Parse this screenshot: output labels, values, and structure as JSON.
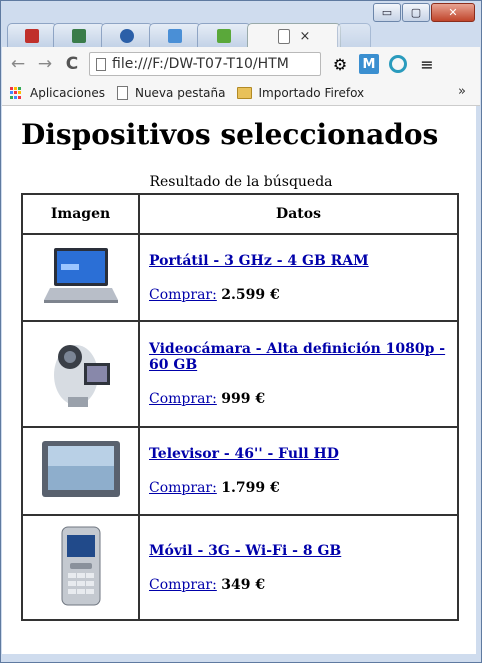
{
  "window": {
    "controls": {
      "minimize": "▭",
      "maximize": "▢",
      "close": "✕"
    }
  },
  "tabs": [
    {
      "icon": "adobe-icon",
      "color": "#c0302b",
      "active": false
    },
    {
      "icon": "image-icon",
      "color": "#3a7c4a",
      "active": false
    },
    {
      "icon": "chart-icon",
      "color": "#2b5fa8",
      "active": false
    },
    {
      "icon": "translate-icon",
      "color": "#4a8fd6",
      "active": false
    },
    {
      "icon": "green-icon",
      "color": "#5aa83a",
      "active": false
    },
    {
      "icon": "document-icon",
      "color": "#ffffff",
      "active": true
    }
  ],
  "active_tab_close": "×",
  "toolbar": {
    "back": "←",
    "forward": "→",
    "reload": "C",
    "url": "file:///F:/DW-T07-T10/HTM",
    "settings": "⚙",
    "ext_m": "M",
    "menu": "≡"
  },
  "bookmarks": {
    "items": [
      {
        "label": "Aplicaciones",
        "icon": "apps-icon"
      },
      {
        "label": "Nueva pestaña",
        "icon": "document-icon"
      },
      {
        "label": "Importado Firefox",
        "icon": "folder-icon"
      }
    ],
    "more": "»"
  },
  "page": {
    "title": "Dispositivos seleccionados",
    "caption": "Resultado de la búsqueda",
    "headers": {
      "image": "Imagen",
      "data": "Datos"
    },
    "buy_label": "Comprar:",
    "rows": [
      {
        "name": "Portátil - 3 GHz - 4 GB RAM",
        "price": "2.599 €",
        "image": "laptop"
      },
      {
        "name": "Videocámara - Alta definición 1080p - 60 GB",
        "price": "999 €",
        "image": "camcorder"
      },
      {
        "name": "Televisor - 46'' - Full HD",
        "price": "1.799 €",
        "image": "tv"
      },
      {
        "name": "Móvil - 3G - Wi-Fi - 8 GB",
        "price": "349 €",
        "image": "mobile"
      }
    ]
  }
}
